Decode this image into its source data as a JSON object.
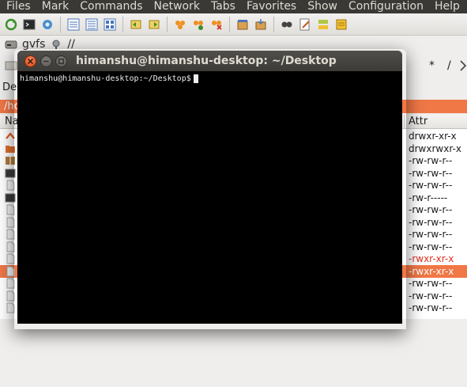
{
  "file_manager": {
    "menu": [
      "Files",
      "Mark",
      "Commands",
      "Network",
      "Tabs",
      "Favorites",
      "Show",
      "Configuration",
      "Help"
    ],
    "toolbar_icons": [
      "refresh-icon",
      "terminal-icon",
      "settings-icon",
      "sep",
      "brief-view-icon",
      "full-view-icon",
      "thumbnail-view-icon",
      "sep",
      "back-icon",
      "forward-icon",
      "sep",
      "network-connect-icon",
      "network-new-icon",
      "network-disconnect-icon",
      "sep",
      "pack-icon",
      "unpack-icon",
      "sep",
      "search-icon",
      "multi-rename-icon",
      "sync-dirs-icon",
      "copy-names-icon"
    ],
    "drive": {
      "name": "gvfs",
      "root_path": "//"
    },
    "path_symbols": [
      "*",
      "/"
    ],
    "tab_label": "De",
    "current_path": "/ho",
    "columns": {
      "name": "Na",
      "attr": "Attr"
    },
    "rows": [
      {
        "icon": "up-arrow-icon",
        "attr": "drwxr-xr-x",
        "exec": false,
        "selected": false
      },
      {
        "icon": "folder-icon",
        "attr": "drwxrwxr-x",
        "exec": false,
        "selected": false
      },
      {
        "icon": "archive-icon",
        "attr": "-rw-rw-r--",
        "exec": false,
        "selected": false
      },
      {
        "icon": "image-icon",
        "attr": "-rw-rw-r--",
        "exec": false,
        "selected": false
      },
      {
        "icon": "file-icon",
        "attr": "-rw-rw-r--",
        "exec": false,
        "selected": false
      },
      {
        "icon": "image-icon",
        "attr": "-rw-r-----",
        "exec": false,
        "selected": false
      },
      {
        "icon": "file-icon",
        "attr": "-rw-rw-r--",
        "exec": false,
        "selected": false
      },
      {
        "icon": "file-icon",
        "attr": "-rw-rw-r--",
        "exec": false,
        "selected": false
      },
      {
        "icon": "file-icon",
        "attr": "-rw-rw-r--",
        "exec": false,
        "selected": false
      },
      {
        "icon": "file-icon",
        "attr": "-rw-rw-r--",
        "exec": false,
        "selected": false
      },
      {
        "icon": "file-icon",
        "attr": "-rwxr-xr-x",
        "exec": true,
        "selected": false
      },
      {
        "icon": "file-icon",
        "attr": "-rwxr-xr-x",
        "exec": true,
        "selected": true
      },
      {
        "icon": "file-icon",
        "attr": "-rw-rw-r--",
        "exec": false,
        "selected": false
      },
      {
        "icon": "file-icon",
        "attr": "-rw-rw-r--",
        "exec": false,
        "selected": false
      },
      {
        "icon": "file-icon",
        "attr": "-rw-rw-r--",
        "exec": false,
        "selected": false
      }
    ],
    "colors": {
      "accent": "#f07746",
      "exec_text": "#e03020",
      "menubar_bg": "#3a3936"
    }
  },
  "terminal": {
    "title": "himanshu@himanshu-desktop: ~/Desktop",
    "prompt": "himanshu@himanshu-desktop:~/Desktop$"
  }
}
